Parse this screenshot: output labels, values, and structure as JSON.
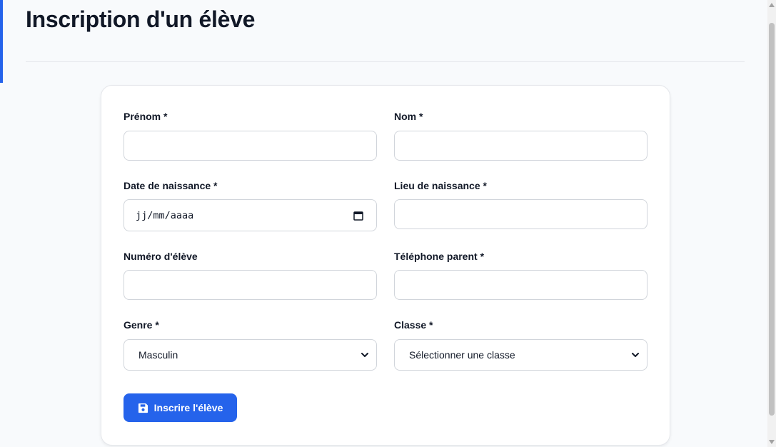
{
  "page": {
    "title": "Inscription d'un élève"
  },
  "form": {
    "first_name": {
      "label": "Prénom *",
      "value": ""
    },
    "last_name": {
      "label": "Nom *",
      "value": ""
    },
    "birth_date": {
      "label": "Date de naissance *",
      "placeholder": "jj/mm/aaaa"
    },
    "birth_place": {
      "label": "Lieu de naissance *",
      "value": ""
    },
    "student_number": {
      "label": "Numéro d'élève",
      "value": ""
    },
    "parent_phone": {
      "label": "Téléphone parent *",
      "value": ""
    },
    "gender": {
      "label": "Genre *",
      "selected": "Masculin"
    },
    "class": {
      "label": "Classe *",
      "selected": "Sélectionner une classe"
    },
    "submit_label": "Inscrire l'élève"
  },
  "colors": {
    "accent": "#2563eb",
    "background": "#f8fafc",
    "card": "#ffffff",
    "border": "#d1d5db"
  },
  "icons": {
    "submit": "save-icon",
    "date": "calendar-icon",
    "select": "chevron-down-icon"
  }
}
